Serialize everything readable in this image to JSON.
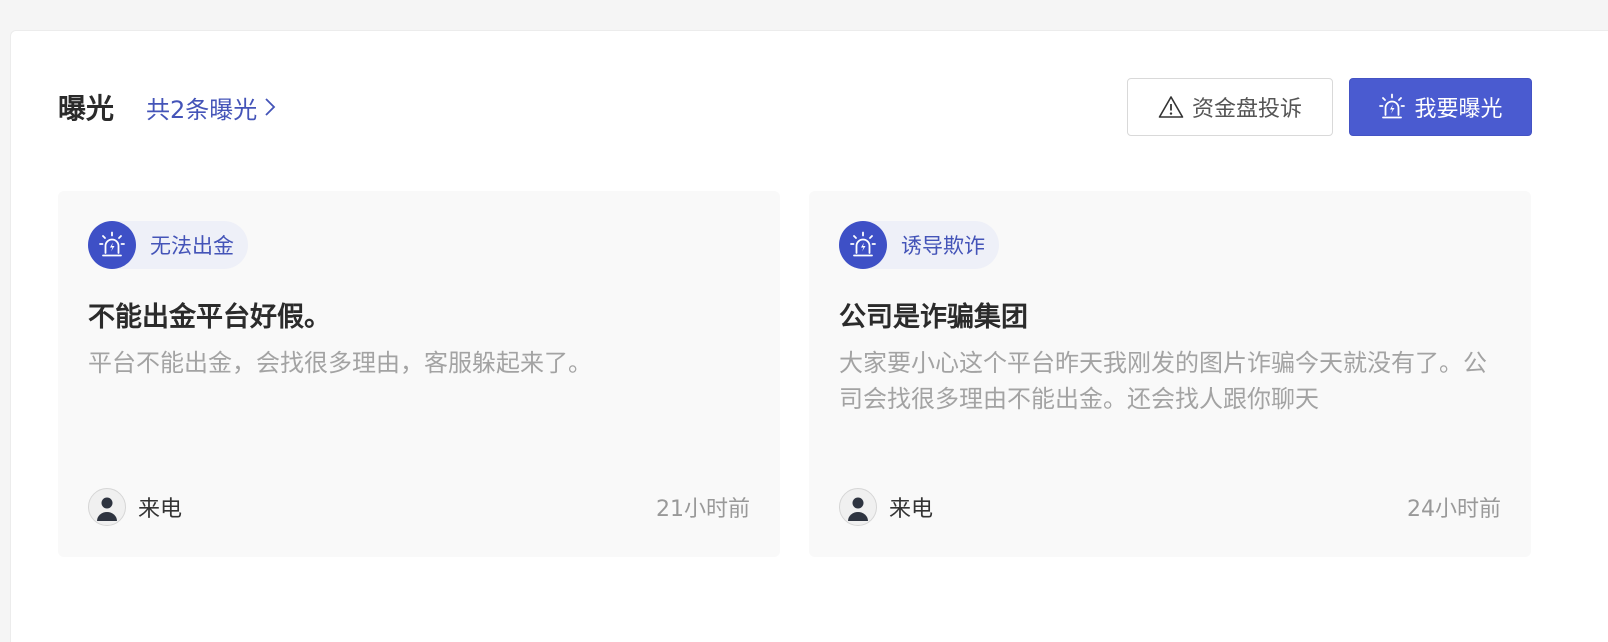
{
  "header": {
    "title": "曝光",
    "total_link": "共2条曝光",
    "complaint_button": "资金盘投诉",
    "expose_button": "我要曝光"
  },
  "colors": {
    "accent": "#4a5bd0",
    "tag_text": "#4454b8",
    "muted": "#a3a3a3"
  },
  "cards": [
    {
      "tag": "无法出金",
      "title": "不能出金平台好假。",
      "description": "平台不能出金，会找很多理由，客服躲起来了。",
      "author": "来电",
      "time": "21小时前"
    },
    {
      "tag": "诱导欺诈",
      "title": "公司是诈骗集团",
      "description": "大家要小心这个平台昨天我刚发的图片诈骗今天就没有了。公司会找很多理由不能出金。还会找人跟你聊天",
      "author": "来电",
      "time": "24小时前"
    }
  ],
  "icons": {
    "warning": "warning-triangle-icon",
    "alarm": "alarm-light-icon",
    "chevron": "chevron-right-icon",
    "user": "user-avatar-icon"
  }
}
